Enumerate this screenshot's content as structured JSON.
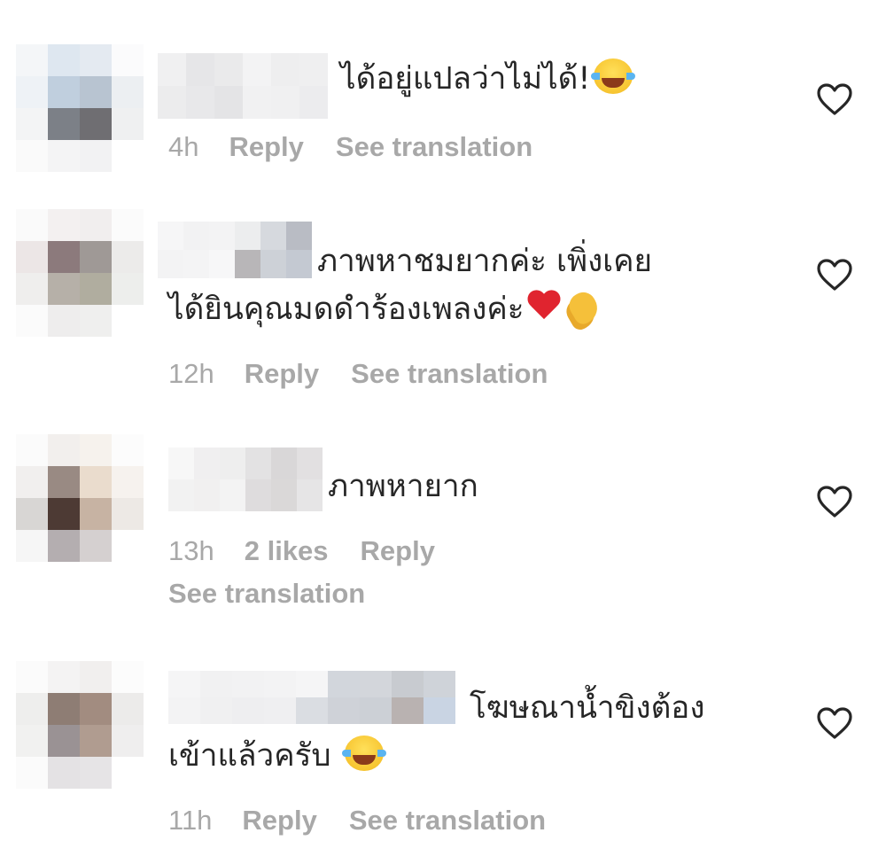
{
  "comments": [
    {
      "text_lines": [
        "ได้อยู่แปลว่าไม่ได้!"
      ],
      "emoji": [
        "face-with-tears-of-joy"
      ],
      "time": "4h",
      "likes": "",
      "reply": "Reply",
      "see_translation": "See translation"
    },
    {
      "text_lines": [
        "ภาพหาชมยากค่ะ เพิ่งเคย",
        "ได้ยินคุณมดดำร้องเพลงค่ะ"
      ],
      "emoji": [
        "red-heart",
        "clapping-hands"
      ],
      "time": "12h",
      "likes": "",
      "reply": "Reply",
      "see_translation": "See translation"
    },
    {
      "text_lines": [
        "ภาพหายาก"
      ],
      "emoji": [],
      "time": "13h",
      "likes": "2 likes",
      "reply": "Reply",
      "see_translation": "See translation"
    },
    {
      "text_lines": [
        "โฆษณาน้ำขิงต้อง",
        "เข้าแล้วครับ"
      ],
      "emoji": [
        "face-with-tears-of-joy"
      ],
      "time": "11h",
      "likes": "",
      "reply": "Reply",
      "see_translation": "See translation"
    }
  ],
  "colors": {
    "text": "#262626",
    "meta": "#a8a8a8",
    "background": "#ffffff"
  }
}
